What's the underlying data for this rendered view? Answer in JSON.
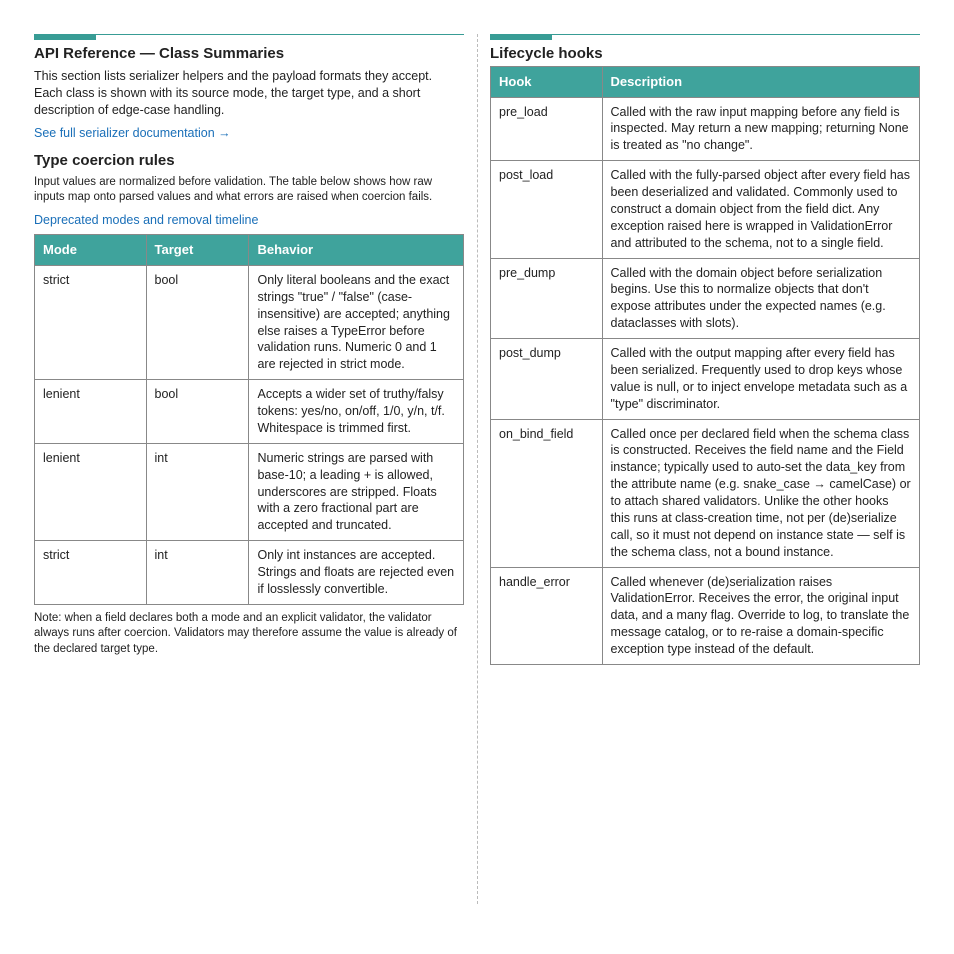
{
  "left": {
    "heading": "API Reference — Class Summaries",
    "intro": "This section lists serializer helpers and the payload formats they accept. Each class is shown with its source mode, the target type, and a short description of edge-case handling.",
    "more_link": "See full serializer documentation →",
    "subheading": "Type coercion rules",
    "rules_intro": "Input values are normalized before validation. The table below shows how raw inputs map onto parsed values and what errors are raised when coercion fails.",
    "deprecation_link": "Deprecated modes and removal timeline",
    "table_headers": [
      "Mode",
      "Target",
      "Behavior"
    ],
    "table_rows": [
      [
        "strict",
        "bool",
        "Only literal booleans and the exact strings \"true\" / \"false\" (case-insensitive) are accepted; anything else raises a TypeError before validation runs. Numeric 0 and 1 are rejected in strict mode."
      ],
      [
        "lenient",
        "bool",
        "Accepts a wider set of truthy/falsy tokens: yes/no, on/off, 1/0, y/n, t/f. Whitespace is trimmed first."
      ],
      [
        "lenient",
        "int",
        "Numeric strings are parsed with base-10; a leading + is allowed, underscores are stripped. Floats with a zero fractional part are accepted and truncated."
      ],
      [
        "strict",
        "int",
        "Only int instances are accepted. Strings and floats are rejected even if losslessly convertible."
      ]
    ],
    "note": "Note: when a field declares both a mode and an explicit validator, the validator always runs after coercion. Validators may therefore assume the value is already of the declared target type."
  },
  "right": {
    "heading": "Lifecycle hooks",
    "table_headers": [
      "Hook",
      "Description"
    ],
    "table_rows": [
      [
        "pre_load",
        "Called with the raw input mapping before any field is inspected. May return a new mapping; returning None is treated as \"no change\"."
      ],
      [
        "post_load",
        "Called with the fully-parsed object after every field has been deserialized and validated. Commonly used to construct a domain object from the field dict. Any exception raised here is wrapped in ValidationError and attributed to the schema, not to a single field."
      ],
      [
        "pre_dump",
        "Called with the domain object before serialization begins. Use this to normalize objects that don't expose attributes under the expected names (e.g. dataclasses with slots)."
      ],
      [
        "post_dump",
        "Called with the output mapping after every field has been serialized. Frequently used to drop keys whose value is null, or to inject envelope metadata such as a \"type\" discriminator."
      ],
      [
        "on_bind_field",
        "Called once per declared field when the schema class is constructed. Receives the field name and the Field instance; typically used to auto-set the data_key from the attribute name (e.g. snake_case → camelCase) or to attach shared validators. Unlike the other hooks this runs at class-creation time, not per (de)serialize call, so it must not depend on instance state — self is the schema class, not a bound instance."
      ],
      [
        "handle_error",
        "Called whenever (de)serialization raises ValidationError. Receives the error, the original input data, and a many flag. Override to log, to translate the message catalog, or to re-raise a domain-specific exception type instead of the default."
      ]
    ]
  }
}
